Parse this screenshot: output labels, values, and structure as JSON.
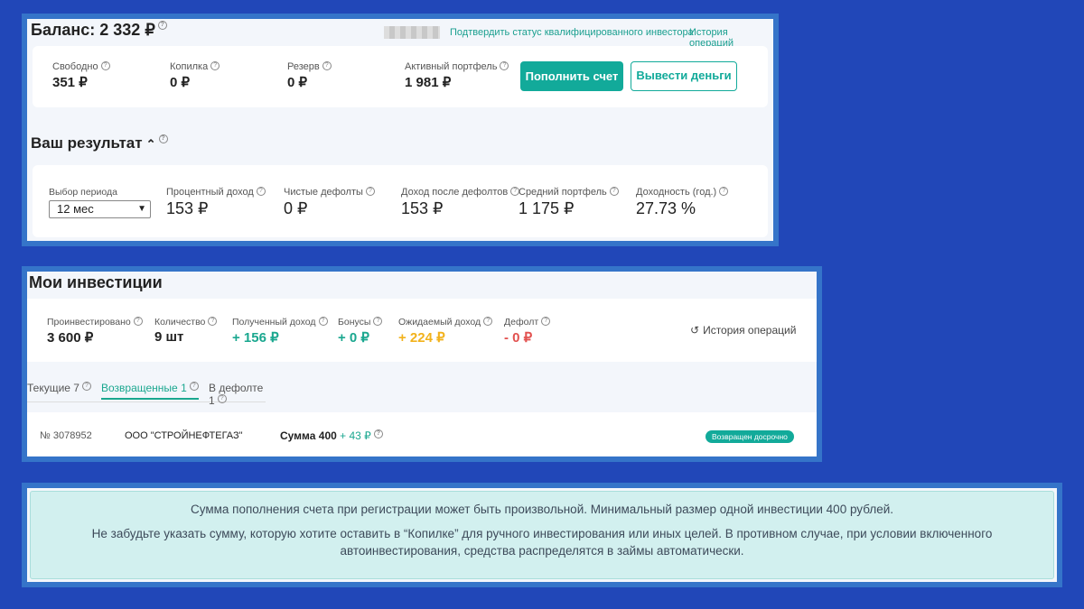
{
  "balance": {
    "title": "Баланс: 2 332 ₽",
    "links": [
      "Подтвердить статус квалифицированного инвестора",
      "История операций"
    ],
    "items": [
      {
        "label": "Свободно",
        "value": "351 ₽"
      },
      {
        "label": "Копилка",
        "value": "0 ₽"
      },
      {
        "label": "Резерв",
        "value": "0 ₽"
      },
      {
        "label": "Активный портфель",
        "value": "1 981 ₽"
      }
    ],
    "deposit_button": "Пополнить счет",
    "withdraw_button": "Вывести деньги"
  },
  "result": {
    "title": "Ваш результат",
    "period_label": "Выбор периода",
    "period_value": "12 мес",
    "items": [
      {
        "label": "Процентный доход",
        "value": "153 ₽"
      },
      {
        "label": "Чистые дефолты",
        "value": "0 ₽"
      },
      {
        "label": "Доход после дефолтов",
        "value": "153 ₽"
      },
      {
        "label": "Средний портфель",
        "value": "1 175 ₽"
      },
      {
        "label": "Доходность (год.)",
        "value": "27.73 %"
      }
    ]
  },
  "investments": {
    "title": "Мои инвестиции",
    "items": [
      {
        "label": "Проинвестировано",
        "value": "3 600 ₽"
      },
      {
        "label": "Количество",
        "value": "9 шт"
      },
      {
        "label": "Полученный доход",
        "value": "+ 156 ₽"
      },
      {
        "label": "Бонусы",
        "value": "+ 0 ₽"
      },
      {
        "label": "Ожидаемый доход",
        "value": "+ 224 ₽"
      },
      {
        "label": "Дефолт",
        "value": "- 0 ₽"
      }
    ],
    "history_link": "История операций",
    "tabs": [
      "Текущие 7",
      "Возвращенные 1",
      "В дефолте 1"
    ],
    "row": {
      "number": "№ 3078952",
      "company": "ООО \"СТРОЙНЕФТЕГАЗ\"",
      "sum_label": "Сумма 400",
      "sum_extra": "+ 43 ₽",
      "status": "Возвращен досрочно"
    }
  },
  "note": {
    "line1": "Сумма пополнения счета при регистрации может быть произвольной. Минимальный размер одной инвестиции 400 рублей.",
    "line2": "Не забудьте указать сумму, которую хотите оставить в “Копилке” для ручного инвестирования или иных целей. В противном случае, при условии включенного автоинвестирования, средства распределятся в займы автоматически."
  },
  "colors": {
    "accent": "#12aa9a",
    "background": "#2147b8",
    "frame": "#3574c9",
    "note_bg": "#d2f0ef"
  }
}
